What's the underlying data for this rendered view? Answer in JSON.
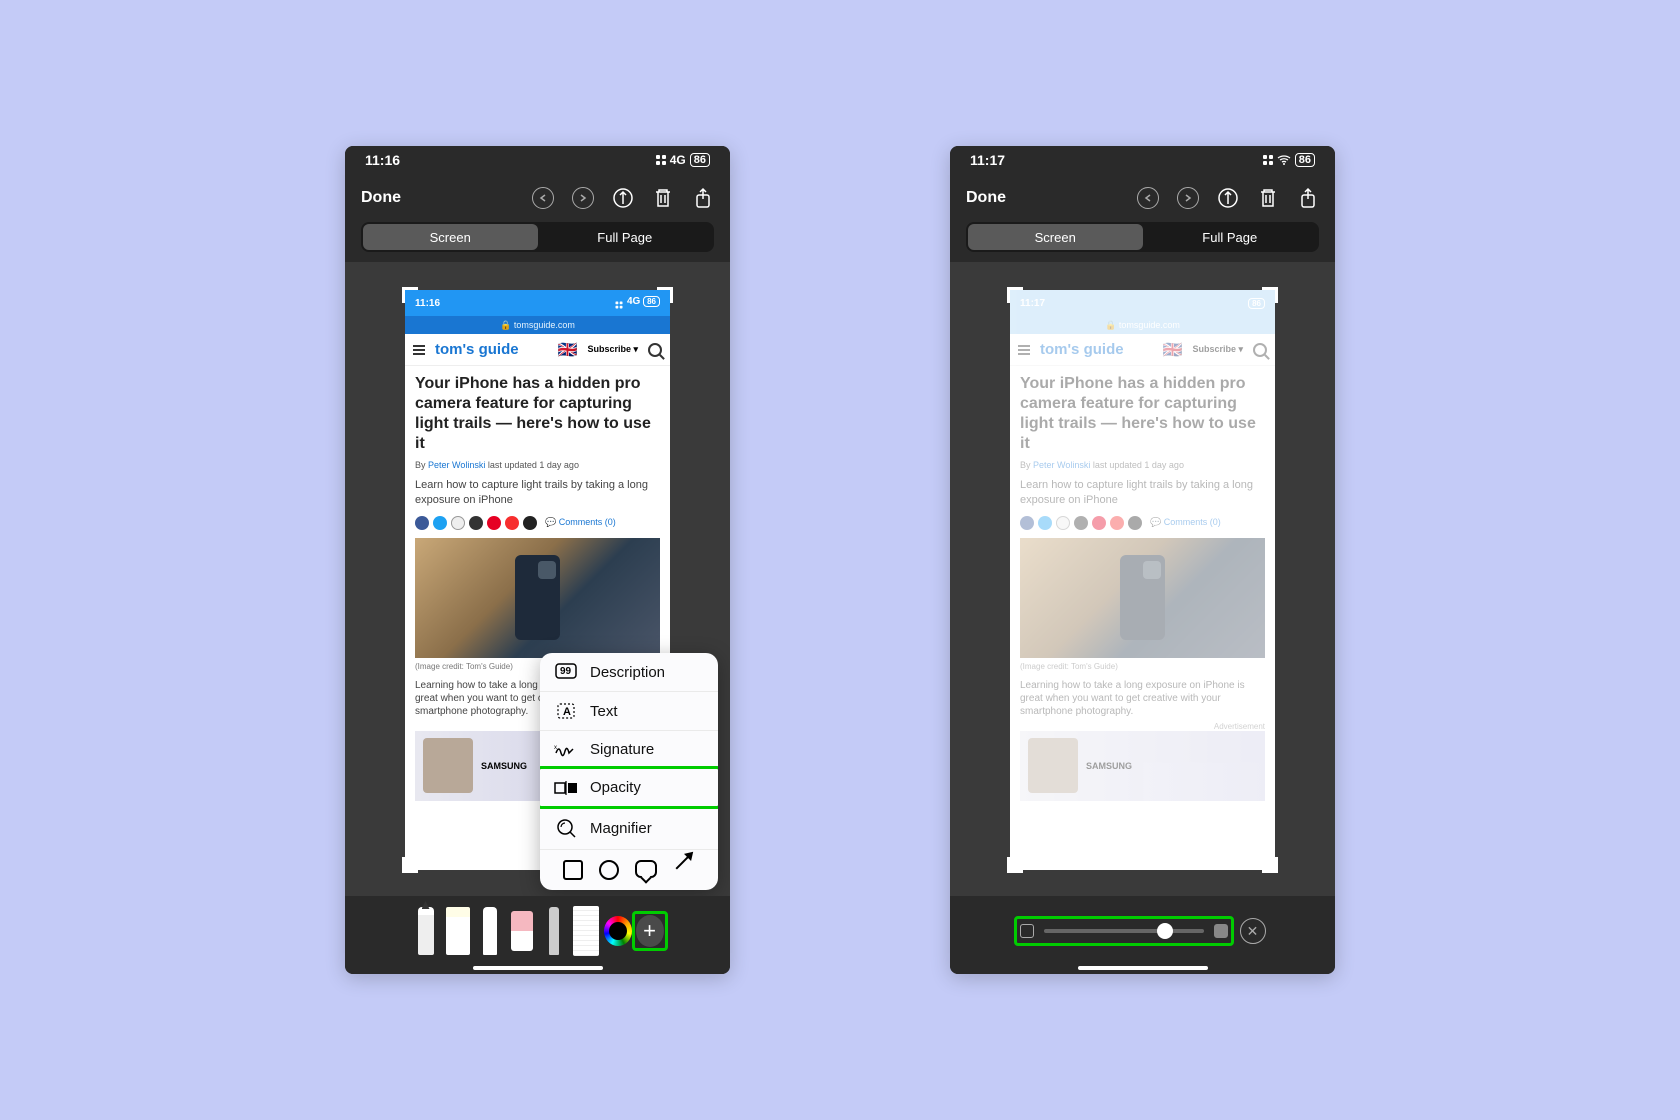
{
  "phones": {
    "left": {
      "status_time": "11:16",
      "net": "4G",
      "battery": "86"
    },
    "right": {
      "status_time": "11:17",
      "net": "",
      "battery": "86"
    }
  },
  "editor": {
    "done": "Done",
    "seg_screen": "Screen",
    "seg_fullpage": "Full Page"
  },
  "screenshot": {
    "status_time": "11:16",
    "net": "4G",
    "battery": "86",
    "url": "tomsguide.com",
    "logo": "tom's guide",
    "subscribe": "Subscribe ▾",
    "headline": "Your iPhone has a hidden pro camera feature for capturing light trails — here's how to use it",
    "byline_prefix": "By ",
    "author": "Peter Wolinski",
    "byline_suffix": " last updated 1 day ago",
    "lede": "Learn how to capture light trails by taking a long exposure on iPhone",
    "comments": "Comments (0)",
    "credit": "(Image credit: Tom's Guide)",
    "body": "Learning how to take a long exposure on iPhone is great when you want to get creative with your smartphone photography.",
    "ad_label": "Advertisement",
    "ad_brand": "SAMSUNG"
  },
  "screenshot_right_time": "11:17",
  "popup": {
    "description": "Description",
    "text": "Text",
    "signature": "Signature",
    "opacity": "Opacity",
    "magnifier": "Magnifier"
  },
  "slider": {
    "position_pct": 76
  }
}
